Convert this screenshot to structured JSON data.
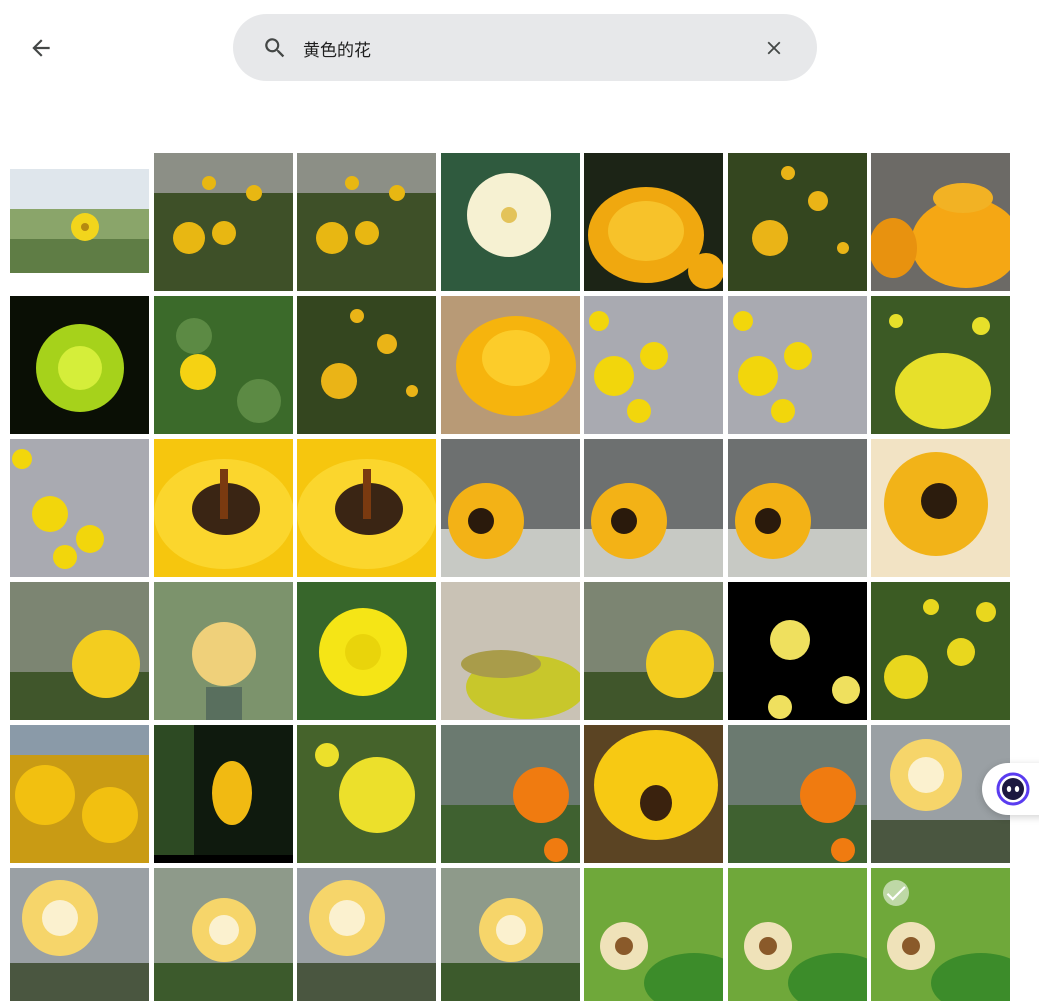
{
  "header": {
    "back_icon": "arrow-left-icon",
    "search": {
      "value": "黄色的花",
      "icon": "search-icon",
      "clear_icon": "close-icon"
    }
  },
  "results": {
    "count_rows": 6,
    "columns": 7,
    "selected_item": "tile-6-7"
  },
  "floating": {
    "assistant_icon": "assistant-face-icon",
    "accent": "#5a3cf0"
  },
  "colors": {
    "search_bg": "#e7e8ea",
    "icon": "#444746",
    "text": "#1f1f1f"
  }
}
